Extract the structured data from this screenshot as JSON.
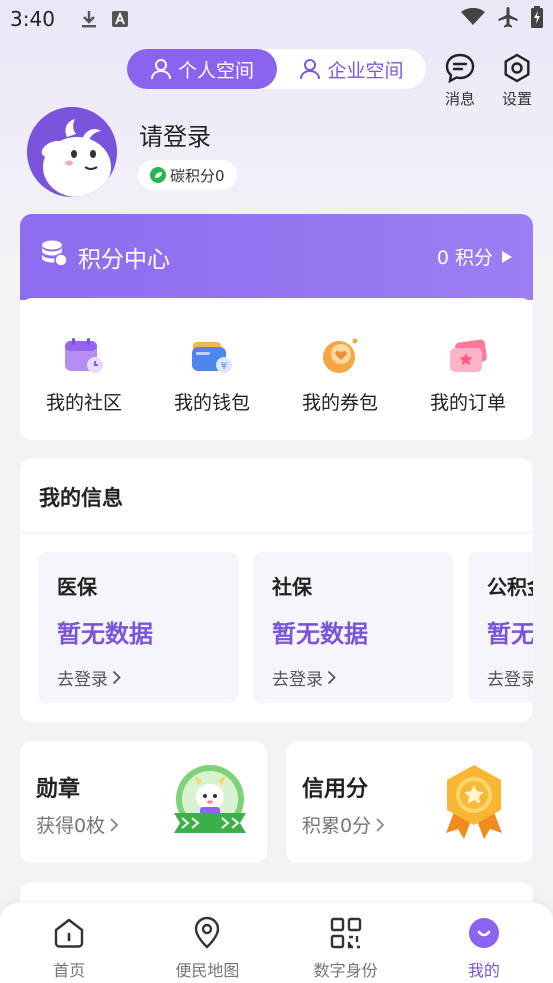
{
  "status_bar": {
    "time": "3:40"
  },
  "header": {
    "tabs": [
      {
        "label": "个人空间",
        "active": true
      },
      {
        "label": "企业空间",
        "active": false
      }
    ],
    "messages_label": "消息",
    "settings_label": "设置"
  },
  "profile": {
    "login_text": "请登录",
    "carbon_label": "碳积分0"
  },
  "points": {
    "title": "积分中心",
    "value": "0 积分",
    "items": [
      {
        "label": "我的社区",
        "icon": "calendar-icon"
      },
      {
        "label": "我的钱包",
        "icon": "wallet-icon"
      },
      {
        "label": "我的券包",
        "icon": "coupon-icon"
      },
      {
        "label": "我的订单",
        "icon": "ticket-icon"
      }
    ]
  },
  "my_info": {
    "title": "我的信息",
    "cards": [
      {
        "name": "医保",
        "status": "暂无数据",
        "action": "去登录"
      },
      {
        "name": "社保",
        "status": "暂无数据",
        "action": "去登录"
      },
      {
        "name": "公积金",
        "status": "暂无数据",
        "action": "去登录"
      }
    ]
  },
  "medals": {
    "title": "勋章",
    "subtitle": "获得0枚"
  },
  "credit": {
    "title": "信用分",
    "subtitle": "积累0分"
  },
  "nav": {
    "items": [
      {
        "label": "首页",
        "icon": "home-icon",
        "active": false
      },
      {
        "label": "便民地图",
        "icon": "map-pin-icon",
        "active": false
      },
      {
        "label": "数字身份",
        "icon": "qr-icon",
        "active": false
      },
      {
        "label": "我的",
        "icon": "profile-icon",
        "active": true
      }
    ]
  },
  "colors": {
    "accent": "#8a63ef",
    "accent_dark": "#7a55dc",
    "background": "#f3f3f7"
  }
}
